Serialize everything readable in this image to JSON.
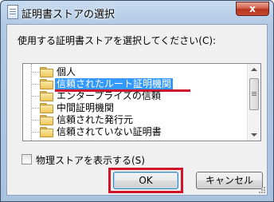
{
  "window": {
    "title": "証明書ストアの選択",
    "close_label": "x"
  },
  "dialog": {
    "instruction": "使用する証明書ストアを選択してください(C):",
    "stores": [
      {
        "label": "個人",
        "selected": false
      },
      {
        "label": "信頼されたルート証明機関",
        "selected": true
      },
      {
        "label": "エンタープライズの信頼",
        "selected": false
      },
      {
        "label": "中間証明機関",
        "selected": false
      },
      {
        "label": "信頼された発行元",
        "selected": false
      },
      {
        "label": "信頼されていない証明書",
        "selected": false
      }
    ],
    "show_physical_label": "物理ストアを表示する(S)",
    "show_physical_checked": false,
    "ok_label": "OK",
    "cancel_label": "キャンセル"
  },
  "colors": {
    "selection": "#3399ff",
    "highlight_annotation": "#d0142c"
  }
}
